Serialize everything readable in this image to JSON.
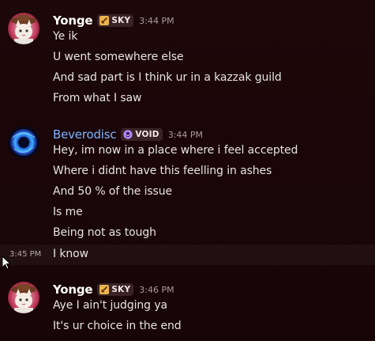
{
  "groups": [
    {
      "username": "Yonge",
      "username_color": "#ffffff",
      "tag": "SKY",
      "tag_icon": "sword-icon",
      "time": "3:44 PM",
      "avatar": "cowboy-cat-avatar",
      "messages": [
        "Ye ik",
        "U went somewhere else",
        "And sad part is I think ur in a kazzak guild",
        "From what I saw"
      ]
    },
    {
      "username": "Beverodisc",
      "username_color": "#7fb3ff",
      "tag": "VOID",
      "tag_icon": "void-orb-icon",
      "time": "3:44 PM",
      "avatar": "blue-vortex-avatar",
      "messages": [
        "Hey, im now in a place where i feel accepted",
        "Where i didnt have this feelling in ashes",
        "And 50  % of the issue",
        "Is me",
        "Being not as tough",
        "I know"
      ],
      "hover_time": "3:45 PM"
    },
    {
      "username": "Yonge",
      "username_color": "#ffffff",
      "tag": "SKY",
      "tag_icon": "sword-icon",
      "time": "3:46 PM",
      "avatar": "cowboy-cat-avatar",
      "messages": [
        "Aye I ain't judging ya",
        "It's ur choice in the end"
      ]
    }
  ],
  "colors": {
    "background": "#1a0608",
    "text": "#e6e3e4",
    "timestamp": "#a89b9d",
    "tag_background": "#3a2326"
  }
}
